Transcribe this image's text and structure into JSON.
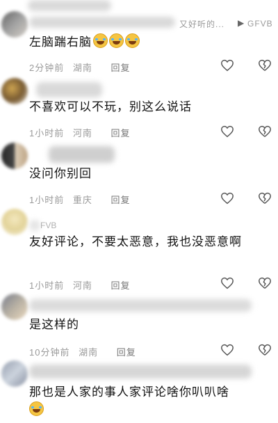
{
  "top_partial": {
    "quote": "又好听的...",
    "badge": "GFVB"
  },
  "comments": [
    {
      "text": "左脑踹右脑",
      "emoji_count": 3,
      "time": "2分钟前",
      "location": "湖南",
      "reply": "回复"
    },
    {
      "text": "不喜欢可以不玩，别这么说话",
      "time": "1小时前",
      "location": "河南",
      "reply": "回复"
    },
    {
      "text": "没问你别回",
      "time": "1小时前",
      "location": "重庆",
      "reply": "回复"
    },
    {
      "name_partial": "FVB",
      "text": "友好评论，不要太恶意，我也没恶意啊",
      "time": "1小时前",
      "location": "河南",
      "reply": "回复"
    },
    {
      "text": "是这样的",
      "time": "10分钟前",
      "location": "湖南",
      "reply": "回复"
    },
    {
      "text": "那也是人家的事人家评论啥你叭叭啥",
      "emoji_count": 1
    }
  ],
  "icons": {
    "like": "heart-outline-icon",
    "dislike": "broken-heart-outline-icon"
  }
}
